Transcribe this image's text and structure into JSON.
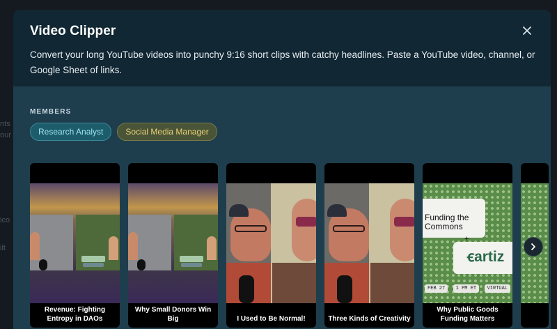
{
  "background": {
    "fragments": [
      "nts",
      "our",
      "ico",
      "ilt"
    ]
  },
  "modal": {
    "title": "Video Clipper",
    "description": "Convert your long YouTube videos into punchy 9:16 short clips with catchy headlines. Paste a YouTube video, channel, or Google Sheet of links.",
    "close_icon": "close-icon"
  },
  "members": {
    "label": "MEMBERS",
    "chips": [
      "Research Analyst",
      "Social Media Manager"
    ]
  },
  "clips": [
    {
      "caption": "Revenue: Fighting Entropy in DAOs",
      "scene": "duo-sunset"
    },
    {
      "caption": "Why Small Donors Win Big",
      "scene": "duo-sunset"
    },
    {
      "caption": "I Used to Be Normal!",
      "scene": "closeup"
    },
    {
      "caption": "Three Kinds of Creativity",
      "scene": "closeup"
    },
    {
      "caption": "Why Public Goods Funding Matters",
      "scene": "funding-commons"
    }
  ],
  "funding_thumb": {
    "line1": "Funding the",
    "line2": "Commons",
    "plus": "+",
    "logo": "ꞓartiz",
    "tags": [
      "FEB 27",
      "1 PM ET",
      "VIRTUAL"
    ]
  },
  "carousel": {
    "next_icon": "chevron-right-icon"
  },
  "colors": {
    "modal_bg": "#1e3e4e",
    "header_bg": "#112733",
    "chip_research_text": "#9fe3ee",
    "chip_social_text": "#e8d27a"
  }
}
